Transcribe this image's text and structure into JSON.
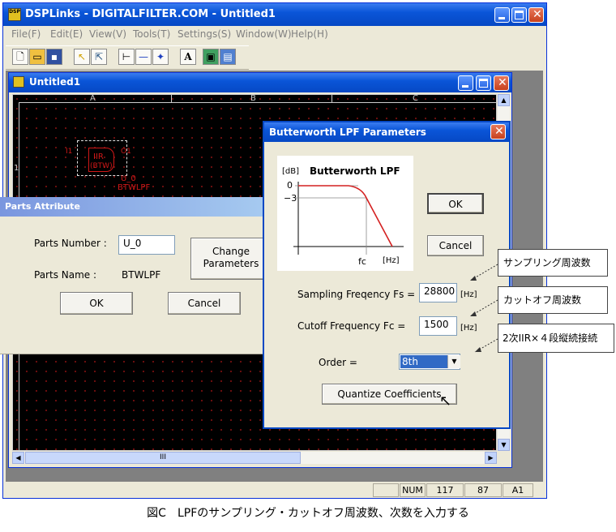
{
  "app": {
    "title": "DSPLinks - DIGITALFILTER.COM - Untitled1",
    "logo": "DSP",
    "menu": [
      "File(F)",
      "Edit(E)",
      "View(V)",
      "Tools(T)",
      "Settings(S)",
      "Window(W)",
      "Help(H)"
    ],
    "toolbar_icons": [
      "new-icon",
      "open-icon",
      "save-icon",
      "pointer-icon",
      "select-icon",
      "wire-icon",
      "line-icon",
      "junction-icon",
      "text-icon",
      "part-icon",
      "window-icon"
    ]
  },
  "child": {
    "title": "Untitled1",
    "col_labels": [
      "A",
      "B",
      "C"
    ],
    "row_label": "1",
    "scroll_thumb_label": "III"
  },
  "schematic": {
    "in_label": "I1",
    "out_label": "O1",
    "block_line1": "IIR",
    "block_line2": "(BTW)",
    "ref": "U_0",
    "name": "BTWLPF"
  },
  "parts_attr": {
    "title": "Parts Attribute",
    "number_label": "Parts Number :",
    "number_value": "U_0",
    "name_label": "Parts Name :",
    "name_value": "BTWLPF",
    "change_label_1": "Change",
    "change_label_2": "Parameters",
    "ok": "OK",
    "cancel": "Cancel"
  },
  "lpf": {
    "title": "Butterworth LPF Parameters",
    "graph_unit": "[dB]",
    "graph_title": "Butterworth LPF",
    "y0": "0",
    "y1": "−3",
    "fc_label": "fc",
    "hz_label": "[Hz]",
    "ok": "OK",
    "cancel": "Cancel",
    "fs_label": "Sampling Freqency Fs =",
    "fs_value": "28800",
    "fc_field_label": "Cutoff Frequency Fc =",
    "fc_value": "1500",
    "unit_hz": "[Hz]",
    "order_label": "Order =",
    "order_value": "8th",
    "quantize": "Quantize Coefficients"
  },
  "annotations": {
    "fs": "サンプリング周波数",
    "fc": "カットオフ周波数",
    "order": "2次IIR×４段縦続接続"
  },
  "status": {
    "num": "NUM",
    "x": "117",
    "y": "87",
    "cell": "A1"
  },
  "caption": "図C　LPFのサンプリング・カットオフ周波数、次数を入力する",
  "colors": {
    "xp_blue": "#0a55d8",
    "dialog_face": "#ece9d8",
    "schematic_red": "#d01818",
    "graph_red": "#d42020"
  }
}
